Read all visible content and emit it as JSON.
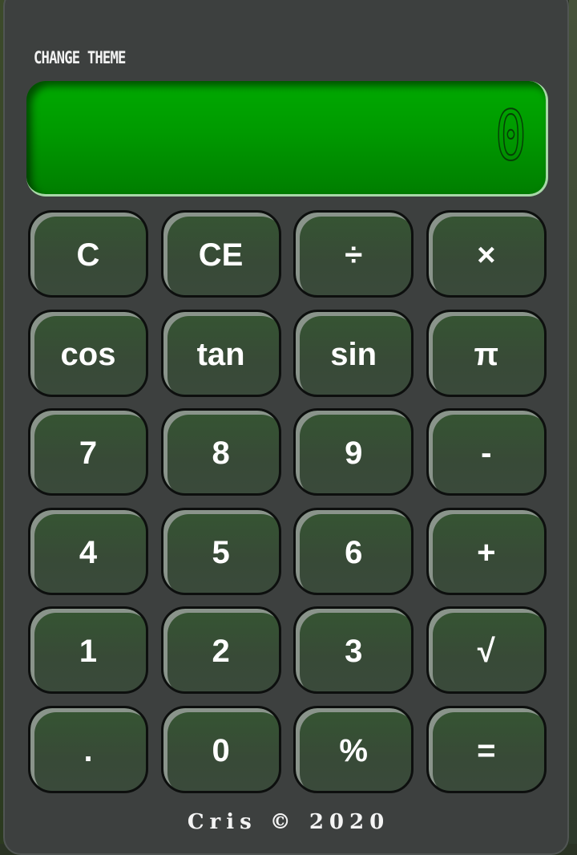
{
  "header": {
    "change_theme_label": "CHANGE THEME"
  },
  "display": {
    "value": "0"
  },
  "keys": [
    {
      "label": "C",
      "name": "clear-button"
    },
    {
      "label": "CE",
      "name": "clear-entry-button"
    },
    {
      "label": "÷",
      "name": "divide-button"
    },
    {
      "label": "×",
      "name": "multiply-button"
    },
    {
      "label": "cos",
      "name": "cos-button"
    },
    {
      "label": "tan",
      "name": "tan-button"
    },
    {
      "label": "sin",
      "name": "sin-button"
    },
    {
      "label": "π",
      "name": "pi-button"
    },
    {
      "label": "7",
      "name": "digit-7-button"
    },
    {
      "label": "8",
      "name": "digit-8-button"
    },
    {
      "label": "9",
      "name": "digit-9-button"
    },
    {
      "label": "-",
      "name": "subtract-button"
    },
    {
      "label": "4",
      "name": "digit-4-button"
    },
    {
      "label": "5",
      "name": "digit-5-button"
    },
    {
      "label": "6",
      "name": "digit-6-button"
    },
    {
      "label": "+",
      "name": "add-button"
    },
    {
      "label": "1",
      "name": "digit-1-button"
    },
    {
      "label": "2",
      "name": "digit-2-button"
    },
    {
      "label": "3",
      "name": "digit-3-button"
    },
    {
      "label": "√",
      "name": "sqrt-button"
    },
    {
      "label": ".",
      "name": "decimal-button"
    },
    {
      "label": "0",
      "name": "digit-0-button"
    },
    {
      "label": "%",
      "name": "percent-button"
    },
    {
      "label": "=",
      "name": "equals-button"
    }
  ],
  "footer": {
    "text": "Cris © 2020"
  },
  "colors": {
    "display_green": "#00aa00",
    "body": "#3d403f",
    "key": "#384a37"
  }
}
